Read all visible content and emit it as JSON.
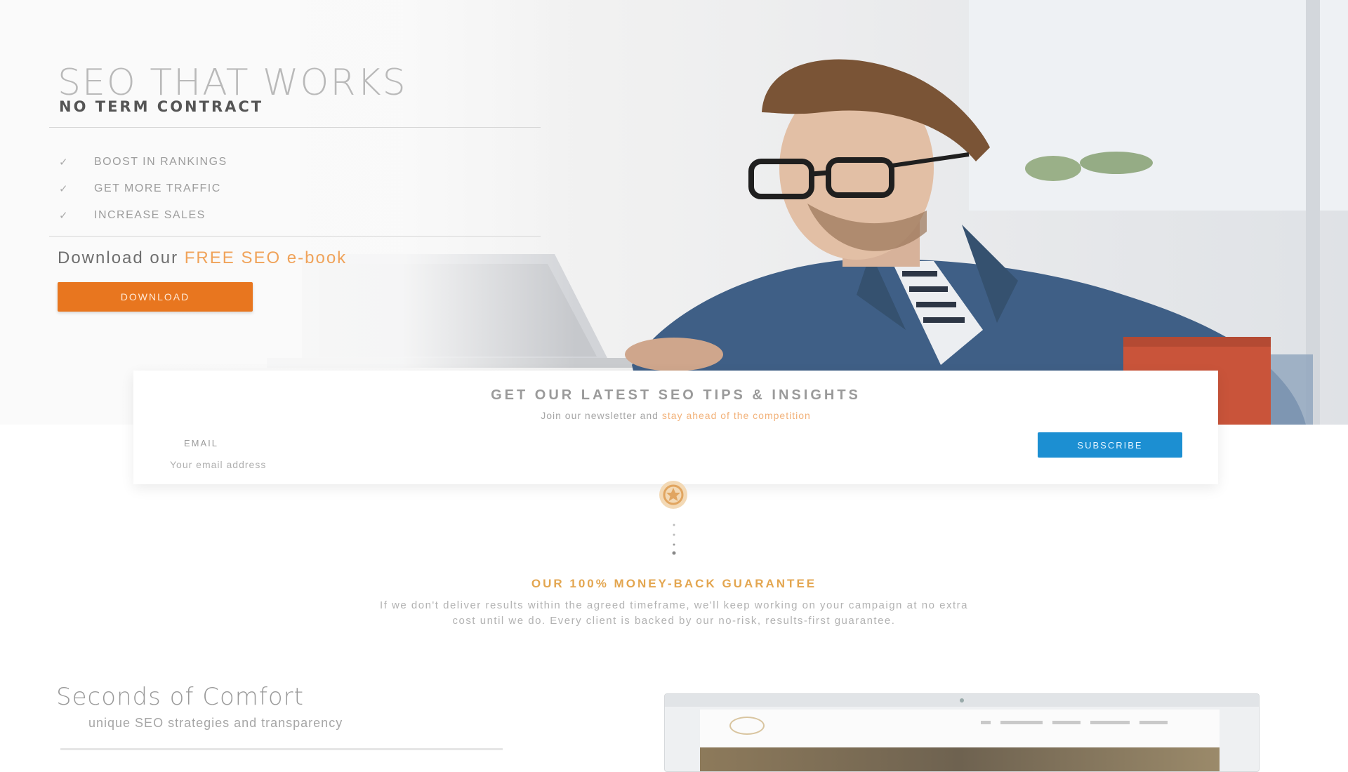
{
  "hero": {
    "title": "SEO THAT WORKS",
    "subtitle": "NO TERM CONTRACT",
    "benefits": [
      {
        "icon": "check-icon",
        "text": "BOOST IN RANKINGS"
      },
      {
        "icon": "check-icon",
        "text": "GET MORE TRAFFIC"
      },
      {
        "icon": "check-icon",
        "text": "INCREASE SALES"
      }
    ],
    "download_prefix": "Download our",
    "download_accent": "FREE SEO e-book",
    "download_button": "DOWNLOAD"
  },
  "subscribe": {
    "title": "GET OUR LATEST SEO TIPS & INSIGHTS",
    "subtitle_prefix": "Join our newsletter and",
    "subtitle_accent": "stay ahead of the competition",
    "email_label": "EMAIL",
    "email_placeholder": "Your email address",
    "button_label": "SUBSCRIBE"
  },
  "guarantee": {
    "icon": "award-badge-icon",
    "title": "OUR 100% MONEY-BACK GUARANTEE",
    "text_line1": "If we don't deliver results within the agreed timeframe, we'll keep working on your campaign at no extra",
    "text_line2": "cost until we do. Every client is backed by our no-risk, results-first guarantee."
  },
  "section": {
    "title": "Seconds of Comfort",
    "subtitle": "unique SEO strategies and transparency"
  },
  "colors": {
    "accent_orange": "#e8761f",
    "accent_blue": "#1c8fd2",
    "accent_gold": "#e3a650"
  }
}
